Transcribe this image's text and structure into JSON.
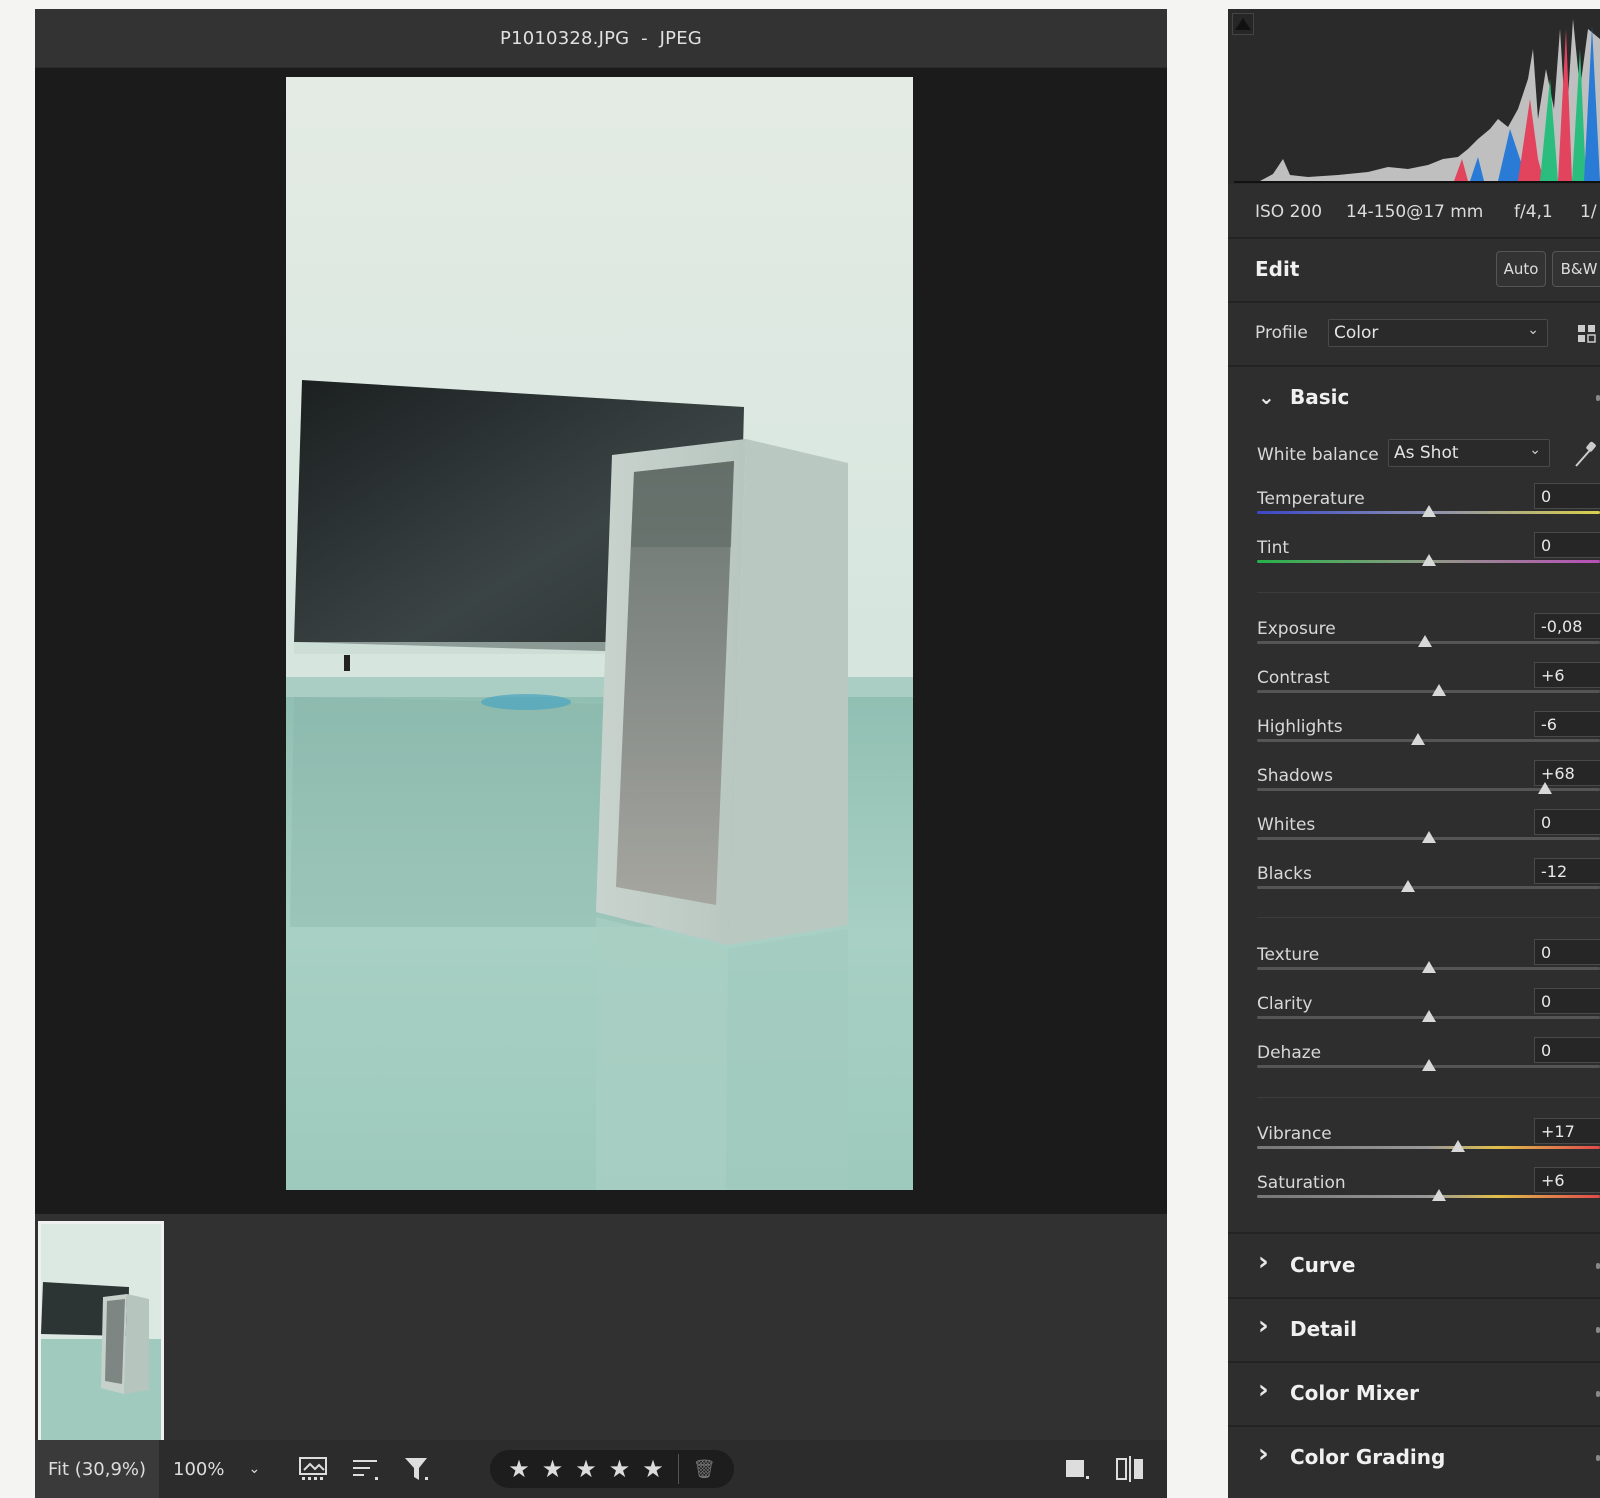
{
  "viewer": {
    "title": "P1010328.JPG  -  JPEG",
    "fit_label": "Fit (30,9%)",
    "zoom_label": "100%"
  },
  "rating": {
    "stars": 5
  },
  "panel": {
    "meta": {
      "iso": "ISO 200",
      "lens": "14-150@17 mm",
      "aperture": "f/4,1",
      "shutter": "1/"
    },
    "edit": {
      "title": "Edit",
      "auto_label": "Auto",
      "bw_label": "B&W"
    },
    "profile": {
      "label": "Profile",
      "value": "Color"
    },
    "basic": {
      "title": "Basic",
      "white_balance": {
        "label": "White balance",
        "value": "As Shot"
      },
      "sliders": [
        {
          "label": "Temperature",
          "value": "0",
          "pos": 0.5
        },
        {
          "label": "Tint",
          "value": "0",
          "pos": 0.5
        },
        {
          "label": "Exposure",
          "value": "-0,08",
          "pos": 0.49
        },
        {
          "label": "Contrast",
          "value": "+6",
          "pos": 0.53
        },
        {
          "label": "Highlights",
          "value": "-6",
          "pos": 0.47
        },
        {
          "label": "Shadows",
          "value": "+68",
          "pos": 0.84
        },
        {
          "label": "Whites",
          "value": "0",
          "pos": 0.5
        },
        {
          "label": "Blacks",
          "value": "-12",
          "pos": 0.44
        },
        {
          "label": "Texture",
          "value": "0",
          "pos": 0.5
        },
        {
          "label": "Clarity",
          "value": "0",
          "pos": 0.5
        },
        {
          "label": "Dehaze",
          "value": "0",
          "pos": 0.5
        },
        {
          "label": "Vibrance",
          "value": "+17",
          "pos": 0.585
        },
        {
          "label": "Saturation",
          "value": "+6",
          "pos": 0.53
        }
      ]
    },
    "sections": [
      {
        "title": "Curve"
      },
      {
        "title": "Detail"
      },
      {
        "title": "Color Mixer"
      },
      {
        "title": "Color Grading"
      }
    ]
  },
  "colors": {
    "panel_bg": "#2e2e2e",
    "viewer_bg": "#1b1b1b",
    "accent_thumb": "#d8d8d8"
  }
}
